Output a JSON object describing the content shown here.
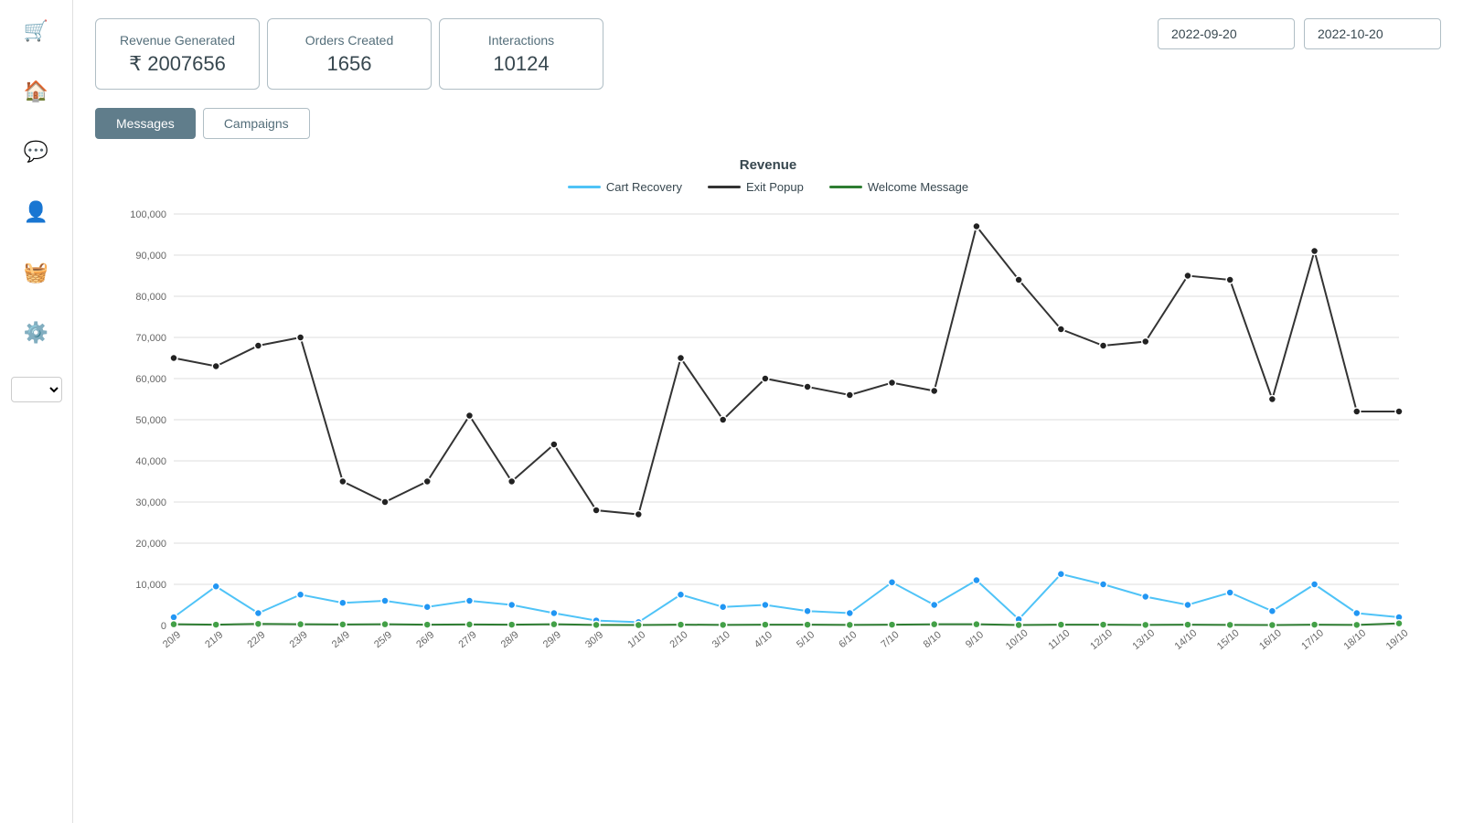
{
  "sidebar": {
    "icons": [
      {
        "name": "cart-icon",
        "symbol": "🛒"
      },
      {
        "name": "home-icon",
        "symbol": "🏠"
      },
      {
        "name": "chat-icon",
        "symbol": "💬"
      },
      {
        "name": "user-icon",
        "symbol": "👤"
      },
      {
        "name": "basket-icon",
        "symbol": "🧺"
      },
      {
        "name": "settings-icon",
        "symbol": "⚙️"
      }
    ]
  },
  "metrics": [
    {
      "label": "Revenue Generated",
      "value": "₹ 2007656"
    },
    {
      "label": "Orders Created",
      "value": "1656"
    },
    {
      "label": "Interactions",
      "value": "10124"
    }
  ],
  "date_from": "2022-09-20",
  "date_to": "2022-10-20",
  "tabs": [
    {
      "label": "Messages",
      "active": true
    },
    {
      "label": "Campaigns",
      "active": false
    }
  ],
  "chart": {
    "title": "Revenue",
    "legend": [
      {
        "label": "Cart Recovery",
        "color": "#4fc3f7"
      },
      {
        "label": "Exit Popup",
        "color": "#333333"
      },
      {
        "label": "Welcome Message",
        "color": "#2e7d32"
      }
    ],
    "x_labels": [
      "20/9",
      "21/9",
      "22/9",
      "23/9",
      "24/9",
      "25/9",
      "26/9",
      "27/9",
      "28/9",
      "29/9",
      "30/9",
      "1/10",
      "2/10",
      "3/10",
      "4/10",
      "5/10",
      "6/10",
      "7/10",
      "8/10",
      "9/10",
      "10/10",
      "11/10",
      "12/10",
      "13/10",
      "14/10",
      "15/10",
      "16/10",
      "17/10",
      "18/10",
      "19/10"
    ],
    "y_labels": [
      "0",
      "10,000",
      "20,000",
      "30,000",
      "40,000",
      "50,000",
      "60,000",
      "70,000",
      "80,000",
      "90,000",
      "100,000"
    ],
    "series": {
      "exit_popup": [
        65000,
        63000,
        68000,
        70000,
        35000,
        30000,
        35000,
        51000,
        35000,
        44000,
        28000,
        27000,
        65000,
        50000,
        60000,
        58000,
        56000,
        59000,
        57000,
        97000,
        84000,
        72000,
        68000,
        69000,
        85000,
        84000,
        55000,
        91000,
        52000,
        52000
      ],
      "cart_recovery": [
        2000,
        9500,
        3000,
        7500,
        5500,
        6000,
        4500,
        6000,
        5000,
        3000,
        1200,
        800,
        7500,
        4500,
        5000,
        3500,
        3000,
        10500,
        5000,
        11000,
        1500,
        12500,
        10000,
        7000,
        5000,
        8000,
        3500,
        10000,
        3000,
        2000
      ],
      "welcome_message": [
        300,
        200,
        400,
        300,
        250,
        300,
        200,
        250,
        200,
        300,
        150,
        100,
        200,
        150,
        200,
        200,
        150,
        200,
        300,
        300,
        100,
        200,
        200,
        150,
        200,
        150,
        100,
        200,
        150,
        500
      ]
    }
  }
}
